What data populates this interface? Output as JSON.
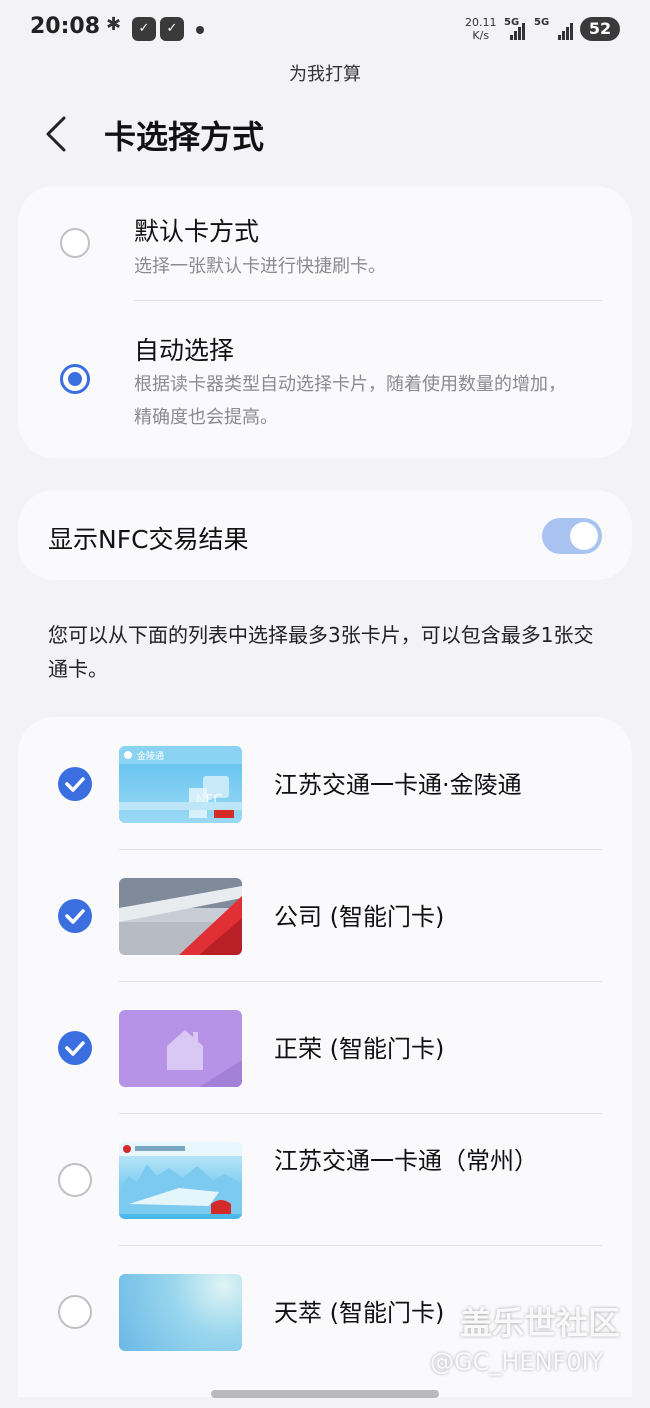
{
  "status_bar": {
    "time": "20:08",
    "speed_value": "20.11",
    "speed_unit": "K/s",
    "net1": "5G",
    "net2": "5G",
    "battery": "52"
  },
  "header": {
    "subtitle": "为我打算",
    "title": "卡选择方式"
  },
  "mode_options": [
    {
      "title": "默认卡方式",
      "desc": "选择一张默认卡进行快捷刷卡。",
      "selected": false
    },
    {
      "title": "自动选择",
      "desc": "根据读卡器类型自动选择卡片，随着使用数量的增加，精确度也会提高。",
      "selected": true
    }
  ],
  "nfc_result": {
    "label": "显示NFC交易结果",
    "enabled": true
  },
  "hint": "您可以从下面的列表中选择最多3张卡片，可以包含最多1张交通卡。",
  "cards": [
    {
      "name": "江苏交通一卡通·金陵通",
      "checked": true,
      "thumb_text": "金陵通"
    },
    {
      "name": "公司 (智能门卡)",
      "checked": true
    },
    {
      "name": "正荣 (智能门卡)",
      "checked": true
    },
    {
      "name": "江苏交通一卡通（常州）",
      "checked": false
    },
    {
      "name": "天萃 (智能门卡)",
      "checked": false
    }
  ],
  "watermark": {
    "line1": "盖乐世社区",
    "line2": "@GC_HENF0IY"
  },
  "colors": {
    "accent": "#3b6fe0",
    "background": "#f2f2f7",
    "card": "#fafafd"
  }
}
